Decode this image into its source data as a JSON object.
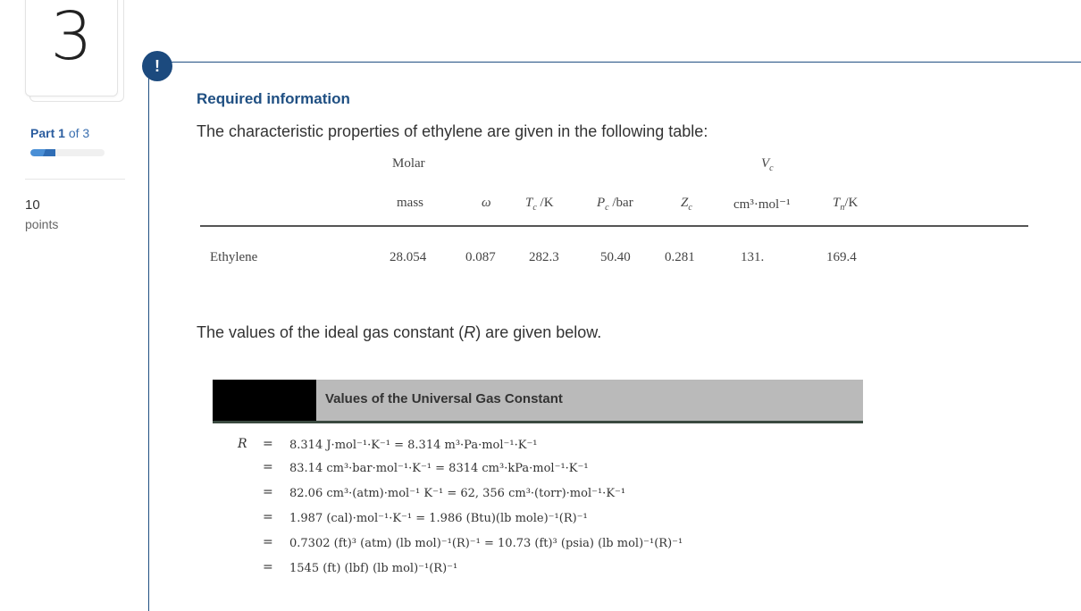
{
  "question": {
    "number": "3",
    "part_label": "Part",
    "part_current": "1",
    "part_of": "of 3",
    "progress_fraction": 0.333,
    "points_value": "10",
    "points_label": "points"
  },
  "alert_icon": "!",
  "required_heading": "Required information",
  "intro_text": "The characteristic properties of ethylene are given in the following table:",
  "properties_table": {
    "header_top": {
      "molar": "Molar",
      "vc": "V",
      "vc_sub": "c"
    },
    "columns": [
      {
        "key": "mass",
        "label": "mass"
      },
      {
        "key": "omega",
        "label": "ω"
      },
      {
        "key": "tc",
        "label": "T",
        "sub": "c",
        "unit": " /K"
      },
      {
        "key": "pc",
        "label": "P",
        "sub": "c",
        "unit": " /bar"
      },
      {
        "key": "zc",
        "label": "Z",
        "sub": "c"
      },
      {
        "key": "vc",
        "label": "cm³·mol⁻¹"
      },
      {
        "key": "tn",
        "label": "T",
        "sub": "n",
        "unit": "/K"
      }
    ],
    "rows": [
      {
        "name": "Ethylene",
        "mass": "28.054",
        "omega": "0.087",
        "tc": "282.3",
        "pc": "50.40",
        "zc": "0.281",
        "vc": "131.",
        "tn": "169.4"
      }
    ]
  },
  "gas_intro": {
    "before": "The values of the ideal gas constant (",
    "symbol": "R",
    "after": ") are given below."
  },
  "gas_box_title": "Values of the Universal Gas Constant",
  "gas_equations": {
    "symbol": "R",
    "equals": "=",
    "lines": [
      "8.314 J·mol⁻¹·K⁻¹ = 8.314 m³·Pa·mol⁻¹·K⁻¹",
      "83.14 cm³·bar·mol⁻¹·K⁻¹ = 8314 cm³·kPa·mol⁻¹·K⁻¹",
      "82.06 cm³·(atm)·mol⁻¹ K⁻¹ = 62, 356 cm³·(torr)·mol⁻¹·K⁻¹",
      "1.987 (cal)·mol⁻¹·K⁻¹ = 1.986 (Btu)(lb mole)⁻¹(R)⁻¹",
      "0.7302 (ft)³ (atm) (lb mol)⁻¹(R)⁻¹ = 10.73 (ft)³ (psia) (lb mol)⁻¹(R)⁻¹",
      "1545 (ft) (lbf) (lb mol)⁻¹(R)⁻¹"
    ]
  }
}
